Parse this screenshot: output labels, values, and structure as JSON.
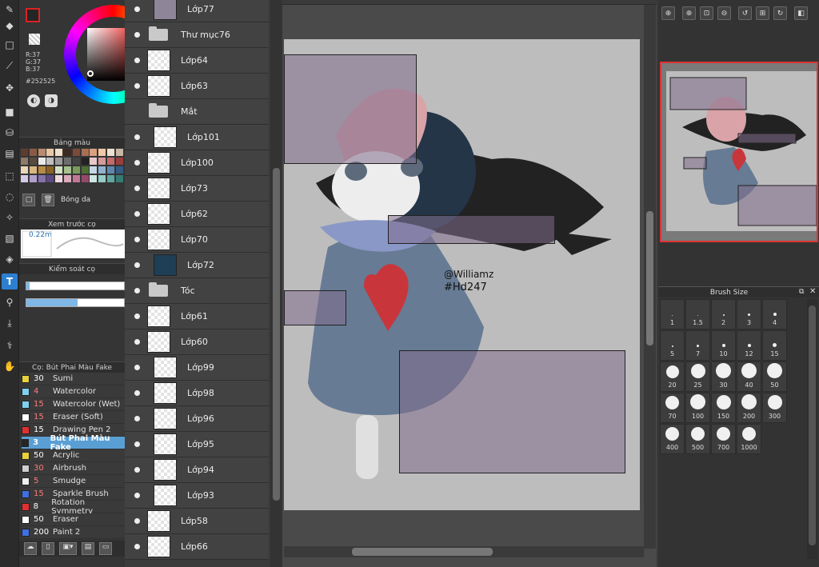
{
  "color_panel": {
    "r": "R:37",
    "g": "G:37",
    "b": "B:37",
    "hex": "#252525",
    "current_color": "#252525"
  },
  "palette_title": "Bảng màu",
  "palette_bottom_label": "Bóng da",
  "brush_preview_title": "Xem trước cọ",
  "brush_preview_value": "0.22m",
  "brush_control_title": "Kiểm soát cọ",
  "brush_list_title": "Cọ: Bút Phai Màu Fake",
  "brushes": [
    {
      "size": "30",
      "name": "Sumi",
      "color": "#e6d23a",
      "size_color": "#ffffff"
    },
    {
      "size": "4",
      "name": "Watercolor",
      "color": "#7fd0f0",
      "size_color": "#ff7a7a"
    },
    {
      "size": "15",
      "name": "Watercolor (Wet)",
      "color": "#7fd0f0",
      "size_color": "#ff7a7a"
    },
    {
      "size": "15",
      "name": "Eraser (Soft)",
      "color": "#ffffff",
      "size_color": "#ff7a7a"
    },
    {
      "size": "15",
      "name": "Drawing Pen 2",
      "color": "#e03030",
      "size_color": "#ffffff"
    },
    {
      "size": "3",
      "name": "Bút Phai Màu Fake",
      "color": "#252525",
      "size_color": "#ffffff",
      "selected": true
    },
    {
      "size": "50",
      "name": "Acrylic",
      "color": "#e6d23a",
      "size_color": "#ffffff"
    },
    {
      "size": "30",
      "name": "Airbrush",
      "color": "#cfcfcf",
      "size_color": "#ff7a7a"
    },
    {
      "size": "5",
      "name": "Smudge",
      "color": "#f0f0f0",
      "size_color": "#ff7a7a"
    },
    {
      "size": "15",
      "name": "Sparkle Brush",
      "color": "#3f6fe0",
      "size_color": "#ff7a7a"
    },
    {
      "size": "8",
      "name": "Rotation Symmetry",
      "color": "#e03030",
      "size_color": "#ffffff"
    },
    {
      "size": "50",
      "name": "Eraser",
      "color": "#ffffff",
      "size_color": "#ffffff"
    },
    {
      "size": "200",
      "name": "Paint 2",
      "color": "#3f6fe0",
      "size_color": "#ffffff"
    }
  ],
  "layers": [
    {
      "name": "Lớp77",
      "type": "layer",
      "indent": true,
      "eye": true,
      "thumb": "#8f8598"
    },
    {
      "name": "Thư mục76",
      "type": "folder",
      "indent": false,
      "eye": true
    },
    {
      "name": "Lớp64",
      "type": "layer",
      "indent": false,
      "eye": true
    },
    {
      "name": "Lớp63",
      "type": "layer",
      "indent": false,
      "eye": true
    },
    {
      "name": "Mắt",
      "type": "folder",
      "indent": false,
      "eye": false
    },
    {
      "name": "Lớp101",
      "type": "layer",
      "indent": true,
      "eye": true
    },
    {
      "name": "Lớp100",
      "type": "layer",
      "indent": false,
      "eye": true
    },
    {
      "name": "Lớp73",
      "type": "layer",
      "indent": false,
      "eye": true
    },
    {
      "name": "Lớp62",
      "type": "layer",
      "indent": false,
      "eye": true
    },
    {
      "name": "Lớp70",
      "type": "layer",
      "indent": false,
      "eye": true
    },
    {
      "name": "Lớp72",
      "type": "layer",
      "indent": true,
      "eye": true,
      "thumb": "#1e3f55"
    },
    {
      "name": "Tóc",
      "type": "folder",
      "indent": false,
      "eye": true
    },
    {
      "name": "Lớp61",
      "type": "layer",
      "indent": false,
      "eye": true
    },
    {
      "name": "Lớp60",
      "type": "layer",
      "indent": false,
      "eye": true
    },
    {
      "name": "Lớp99",
      "type": "layer",
      "indent": true,
      "eye": true
    },
    {
      "name": "Lớp98",
      "type": "layer",
      "indent": true,
      "eye": true
    },
    {
      "name": "Lớp96",
      "type": "layer",
      "indent": true,
      "eye": true
    },
    {
      "name": "Lớp95",
      "type": "layer",
      "indent": true,
      "eye": true
    },
    {
      "name": "Lớp94",
      "type": "layer",
      "indent": true,
      "eye": true
    },
    {
      "name": "Lớp93",
      "type": "layer",
      "indent": true,
      "eye": true
    },
    {
      "name": "Lớp58",
      "type": "layer",
      "indent": false,
      "eye": true
    },
    {
      "name": "Lớp66",
      "type": "layer",
      "indent": false,
      "eye": true
    }
  ],
  "canvas_signature": [
    "@Williamz",
    "#Hd247"
  ],
  "brush_size_title": "Brush Size",
  "brush_sizes": [
    "1",
    "1.5",
    "2",
    "3",
    "4",
    "5",
    "7",
    "10",
    "12",
    "15",
    "20",
    "25",
    "30",
    "40",
    "50",
    "70",
    "100",
    "150",
    "200",
    "300",
    "400",
    "500",
    "700",
    "1000"
  ]
}
